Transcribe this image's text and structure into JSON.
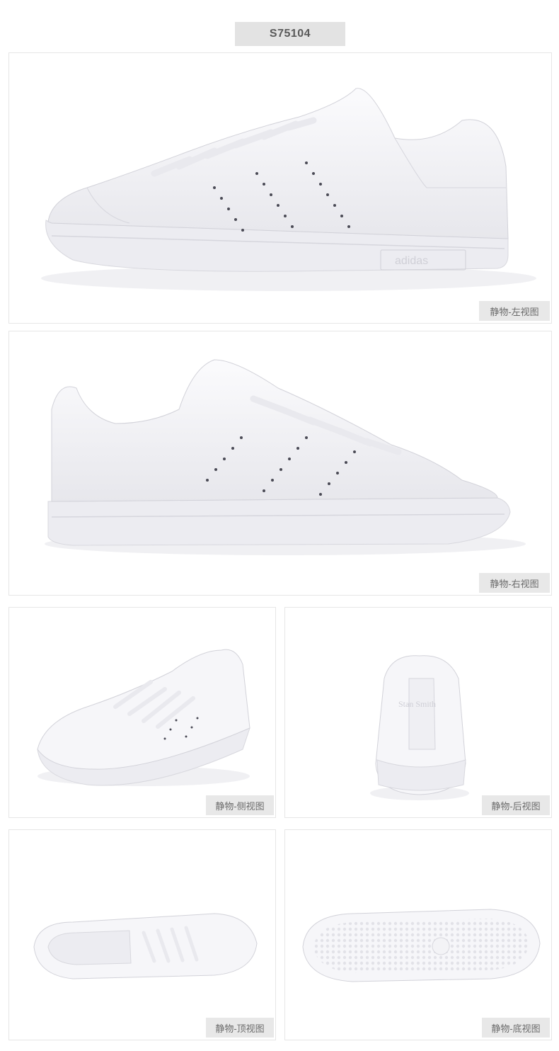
{
  "header": {
    "sku": "S75104"
  },
  "panels": [
    {
      "caption": "静物-左视图"
    },
    {
      "caption": "静物-右视图"
    },
    {
      "caption": "静物-侧视图"
    },
    {
      "caption": "静物-后视图"
    },
    {
      "caption": "静物-顶视图"
    },
    {
      "caption": "静物-底视图"
    }
  ],
  "product": {
    "brand_logo_text": "adidas",
    "heel_text": "Stan Smith",
    "color": "#f4f4f7"
  }
}
